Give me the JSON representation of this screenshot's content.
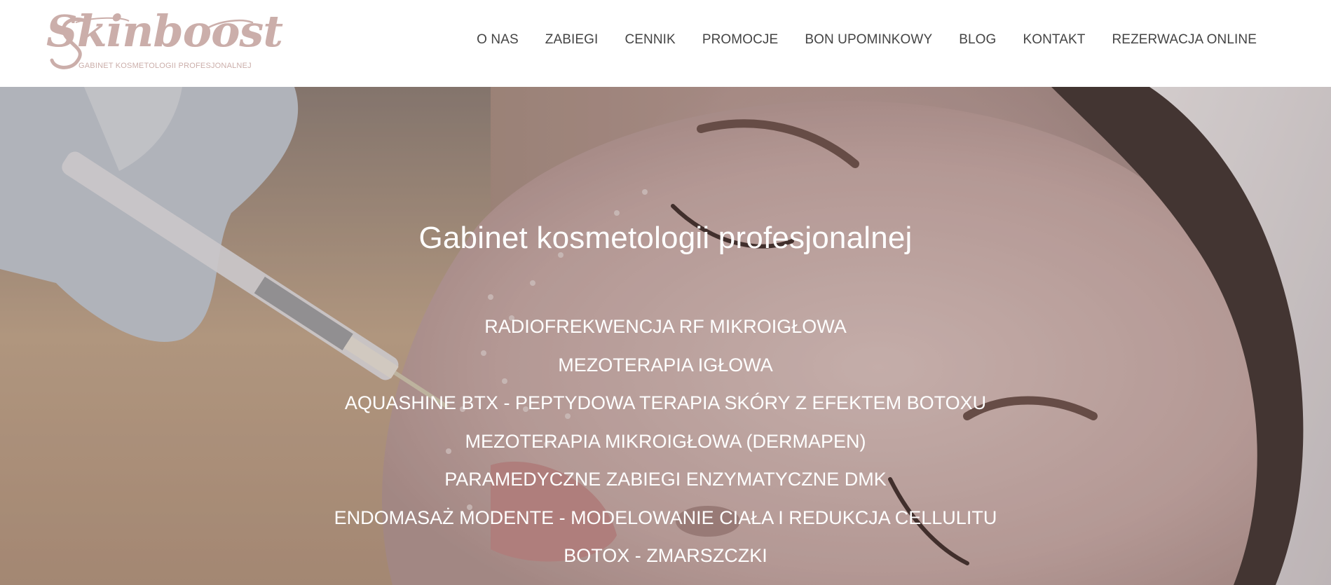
{
  "logo": {
    "name": "Skinboost",
    "tagline": "GABINET KOSMETOLOGII PROFESJONALNEJ"
  },
  "nav": {
    "items": [
      "O NAS",
      "ZABIEGI",
      "CENNIK",
      "PROMOCJE",
      "BON UPOMINKOWY",
      "BLOG",
      "KONTAKT",
      "REZERWACJA ONLINE"
    ]
  },
  "hero": {
    "title": "Gabinet kosmetologii profesjonalnej",
    "services": [
      "RADIOFREKWENCJA RF MIKROIGŁOWA",
      "MEZOTERAPIA IGŁOWA",
      "AQUASHINE BTX - PEPTYDOWA TERAPIA SKÓRY Z EFEKTEM BOTOXU",
      "MEZOTERAPIA MIKROIGŁOWA (DERMAPEN)",
      "PARAMEDYCZNE ZABIEGI ENZYMATYCZNE DMK",
      "ENDOMASAŻ MODENTE - MODELOWANIE CIAŁA I REDUKCJA CELLULITU",
      "BOTOX - ZMARSZCZKI"
    ]
  },
  "colors": {
    "brand": "#cbaeaa",
    "nav_text": "#444444",
    "hero_text": "#ffffff"
  }
}
